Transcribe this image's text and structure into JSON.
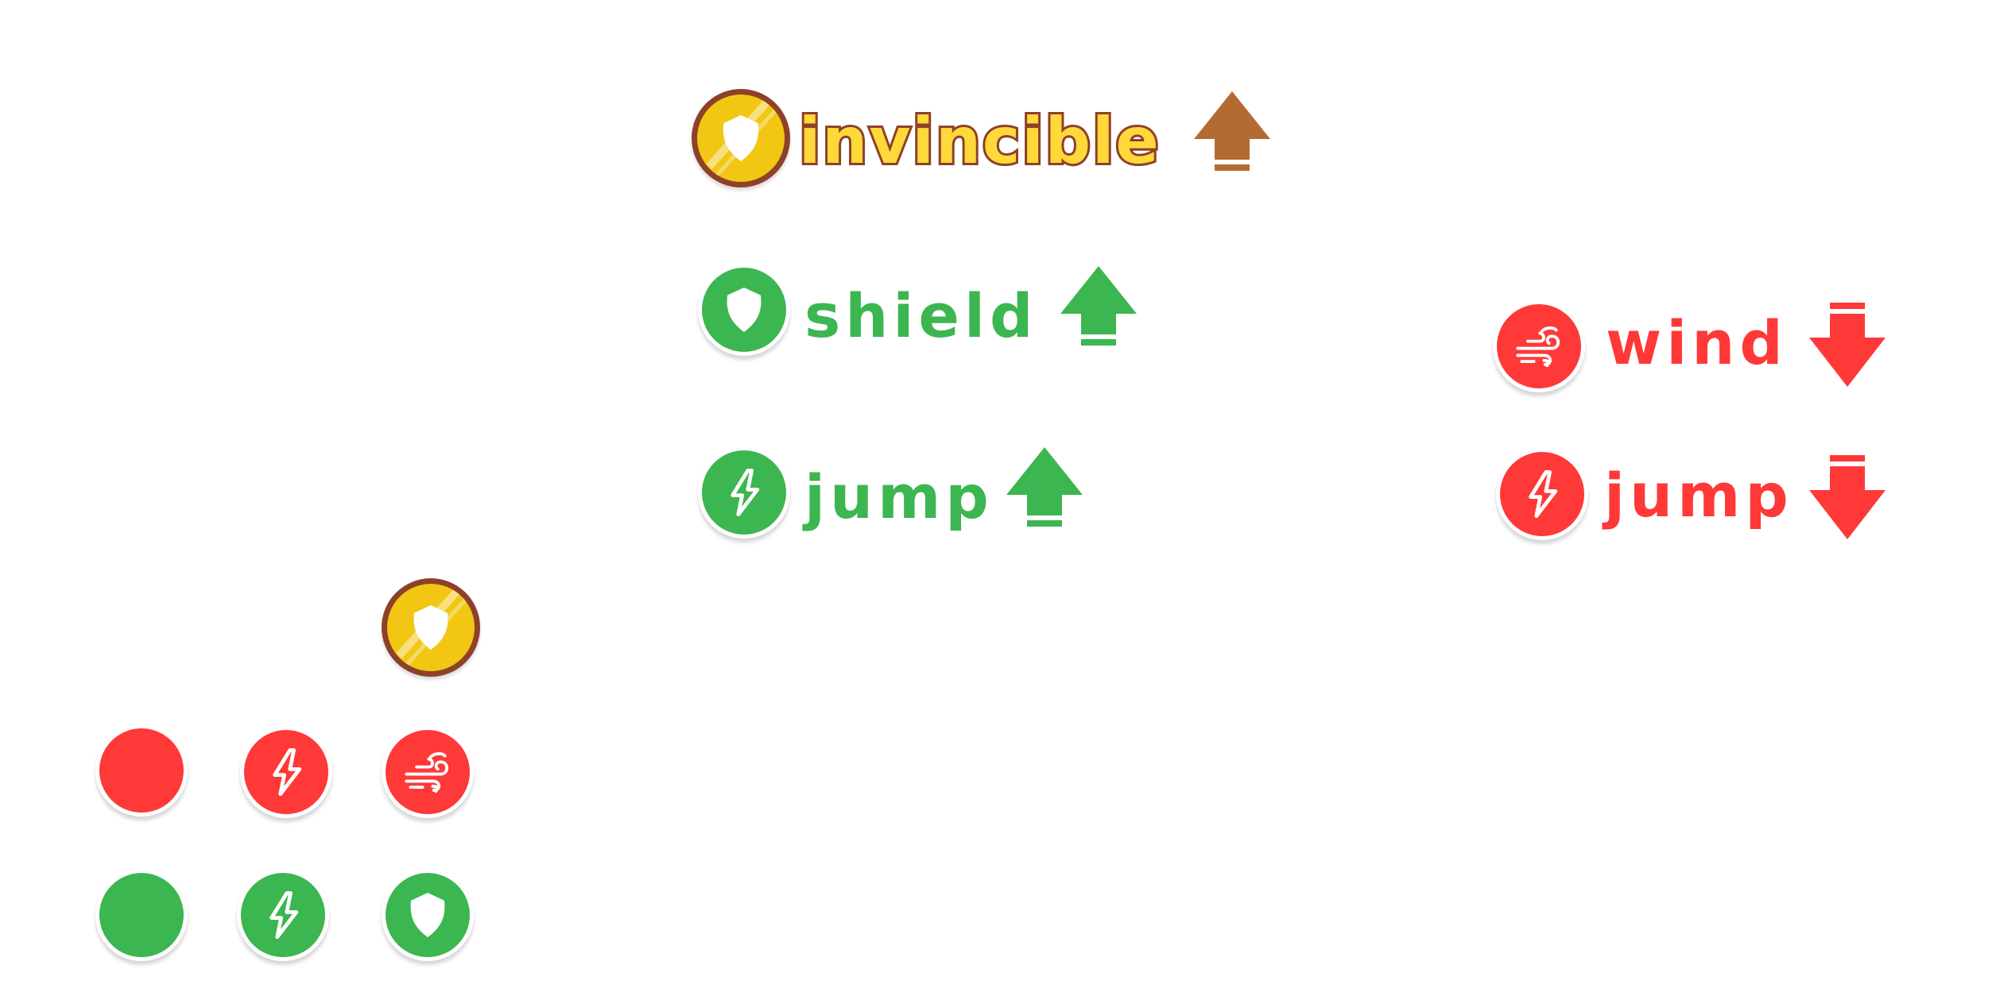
{
  "colors": {
    "green": "#3cb650",
    "red": "#ff3838",
    "gold": "#f1c713",
    "gold_text": "#ffd83a",
    "brown": "#8e4128",
    "arrow_brown": "#b46a33",
    "white": "#ffffff"
  },
  "powerups": {
    "invincible": {
      "label": "invincible",
      "icon": "shield-icon",
      "effect": "up"
    },
    "shield": {
      "label": "shield",
      "icon": "shield-icon",
      "effect": "up"
    },
    "jump_up": {
      "label": "jump",
      "icon": "lightning-icon",
      "effect": "up"
    },
    "wind": {
      "label": "wind",
      "icon": "wind-icon",
      "effect": "down"
    },
    "jump_down": {
      "label": "jump",
      "icon": "lightning-icon",
      "effect": "down"
    }
  },
  "sprite_sheet": {
    "row_gold": [
      "shield-icon"
    ],
    "row_red": [
      "blank",
      "lightning-icon",
      "wind-icon"
    ],
    "row_green": [
      "blank",
      "lightning-icon",
      "shield-icon"
    ]
  }
}
